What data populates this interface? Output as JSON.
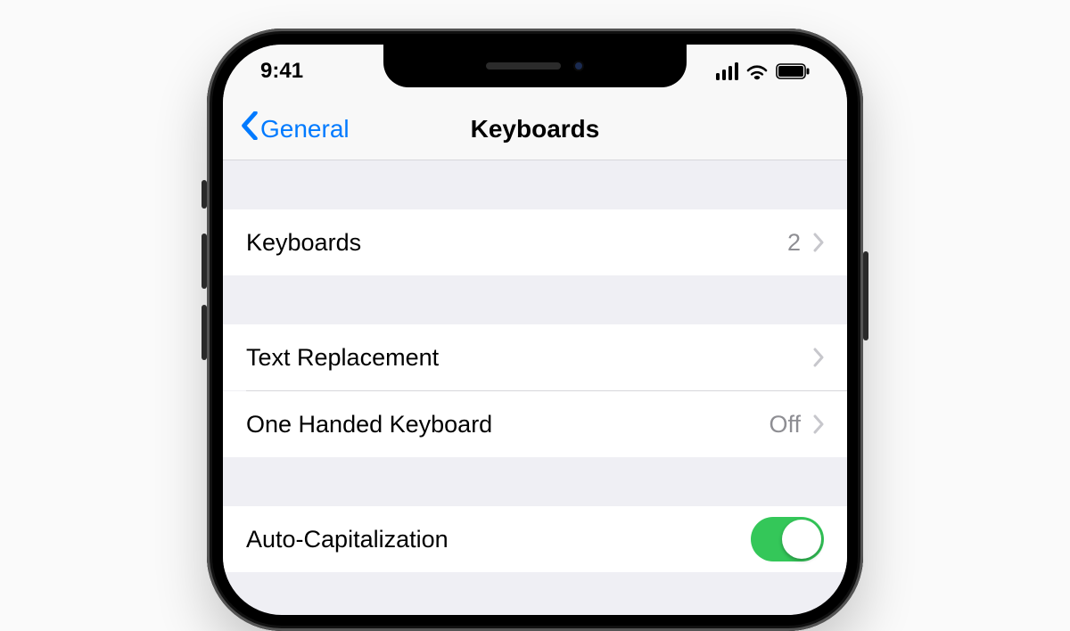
{
  "status": {
    "time": "9:41"
  },
  "nav": {
    "back_label": "General",
    "title": "Keyboards"
  },
  "rows": {
    "keyboards": {
      "label": "Keyboards",
      "value": "2"
    },
    "text_replacement": {
      "label": "Text Replacement"
    },
    "one_handed": {
      "label": "One Handed Keyboard",
      "value": "Off"
    },
    "auto_cap": {
      "label": "Auto-Capitalization",
      "on": true
    }
  }
}
